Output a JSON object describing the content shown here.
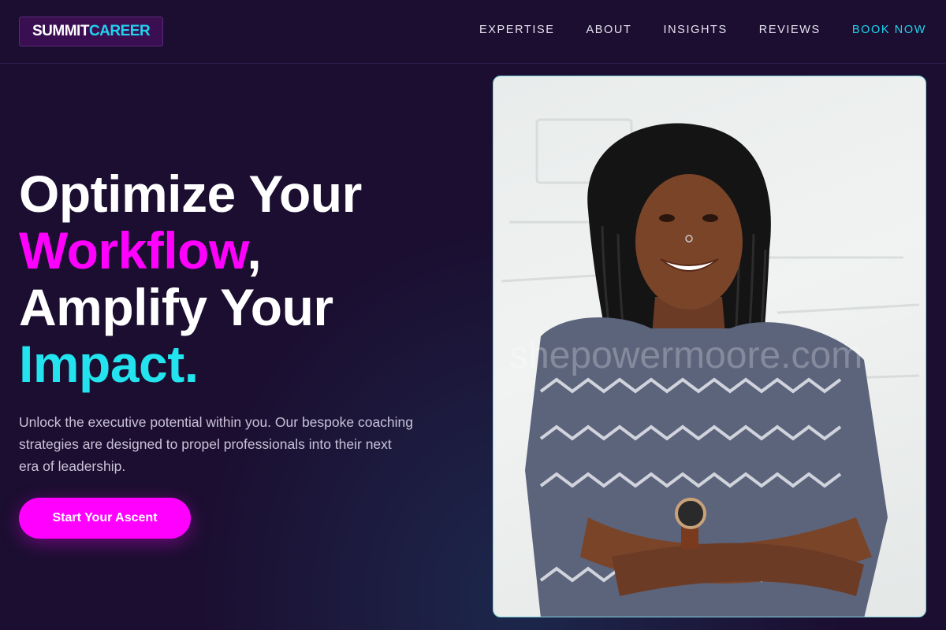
{
  "header": {
    "logo": {
      "part1": "SUMMIT",
      "part2": "CAREER"
    },
    "nav": [
      {
        "label": "EXPERTISE"
      },
      {
        "label": "ABOUT"
      },
      {
        "label": "INSIGHTS"
      },
      {
        "label": "REVIEWS"
      },
      {
        "label": "BOOK NOW"
      }
    ]
  },
  "hero": {
    "headline": {
      "line1": "Optimize Your",
      "line2_highlight": "Workflow",
      "line2_rest": ",",
      "line3": "Amplify Your",
      "line4_highlight": "Impact",
      "line4_rest": "."
    },
    "subtitle": "Unlock the executive potential within you. Our bespoke coaching strategies are designed to propel professionals into their next era of leadership.",
    "cta_label": "Start Your Ascent"
  },
  "photo": {
    "watermark": "shepowermoore.com"
  },
  "colors": {
    "background": "#1b0e30",
    "accent_magenta": "#ff00ff",
    "accent_cyan": "#22d3ee",
    "text": "#ffffff"
  }
}
